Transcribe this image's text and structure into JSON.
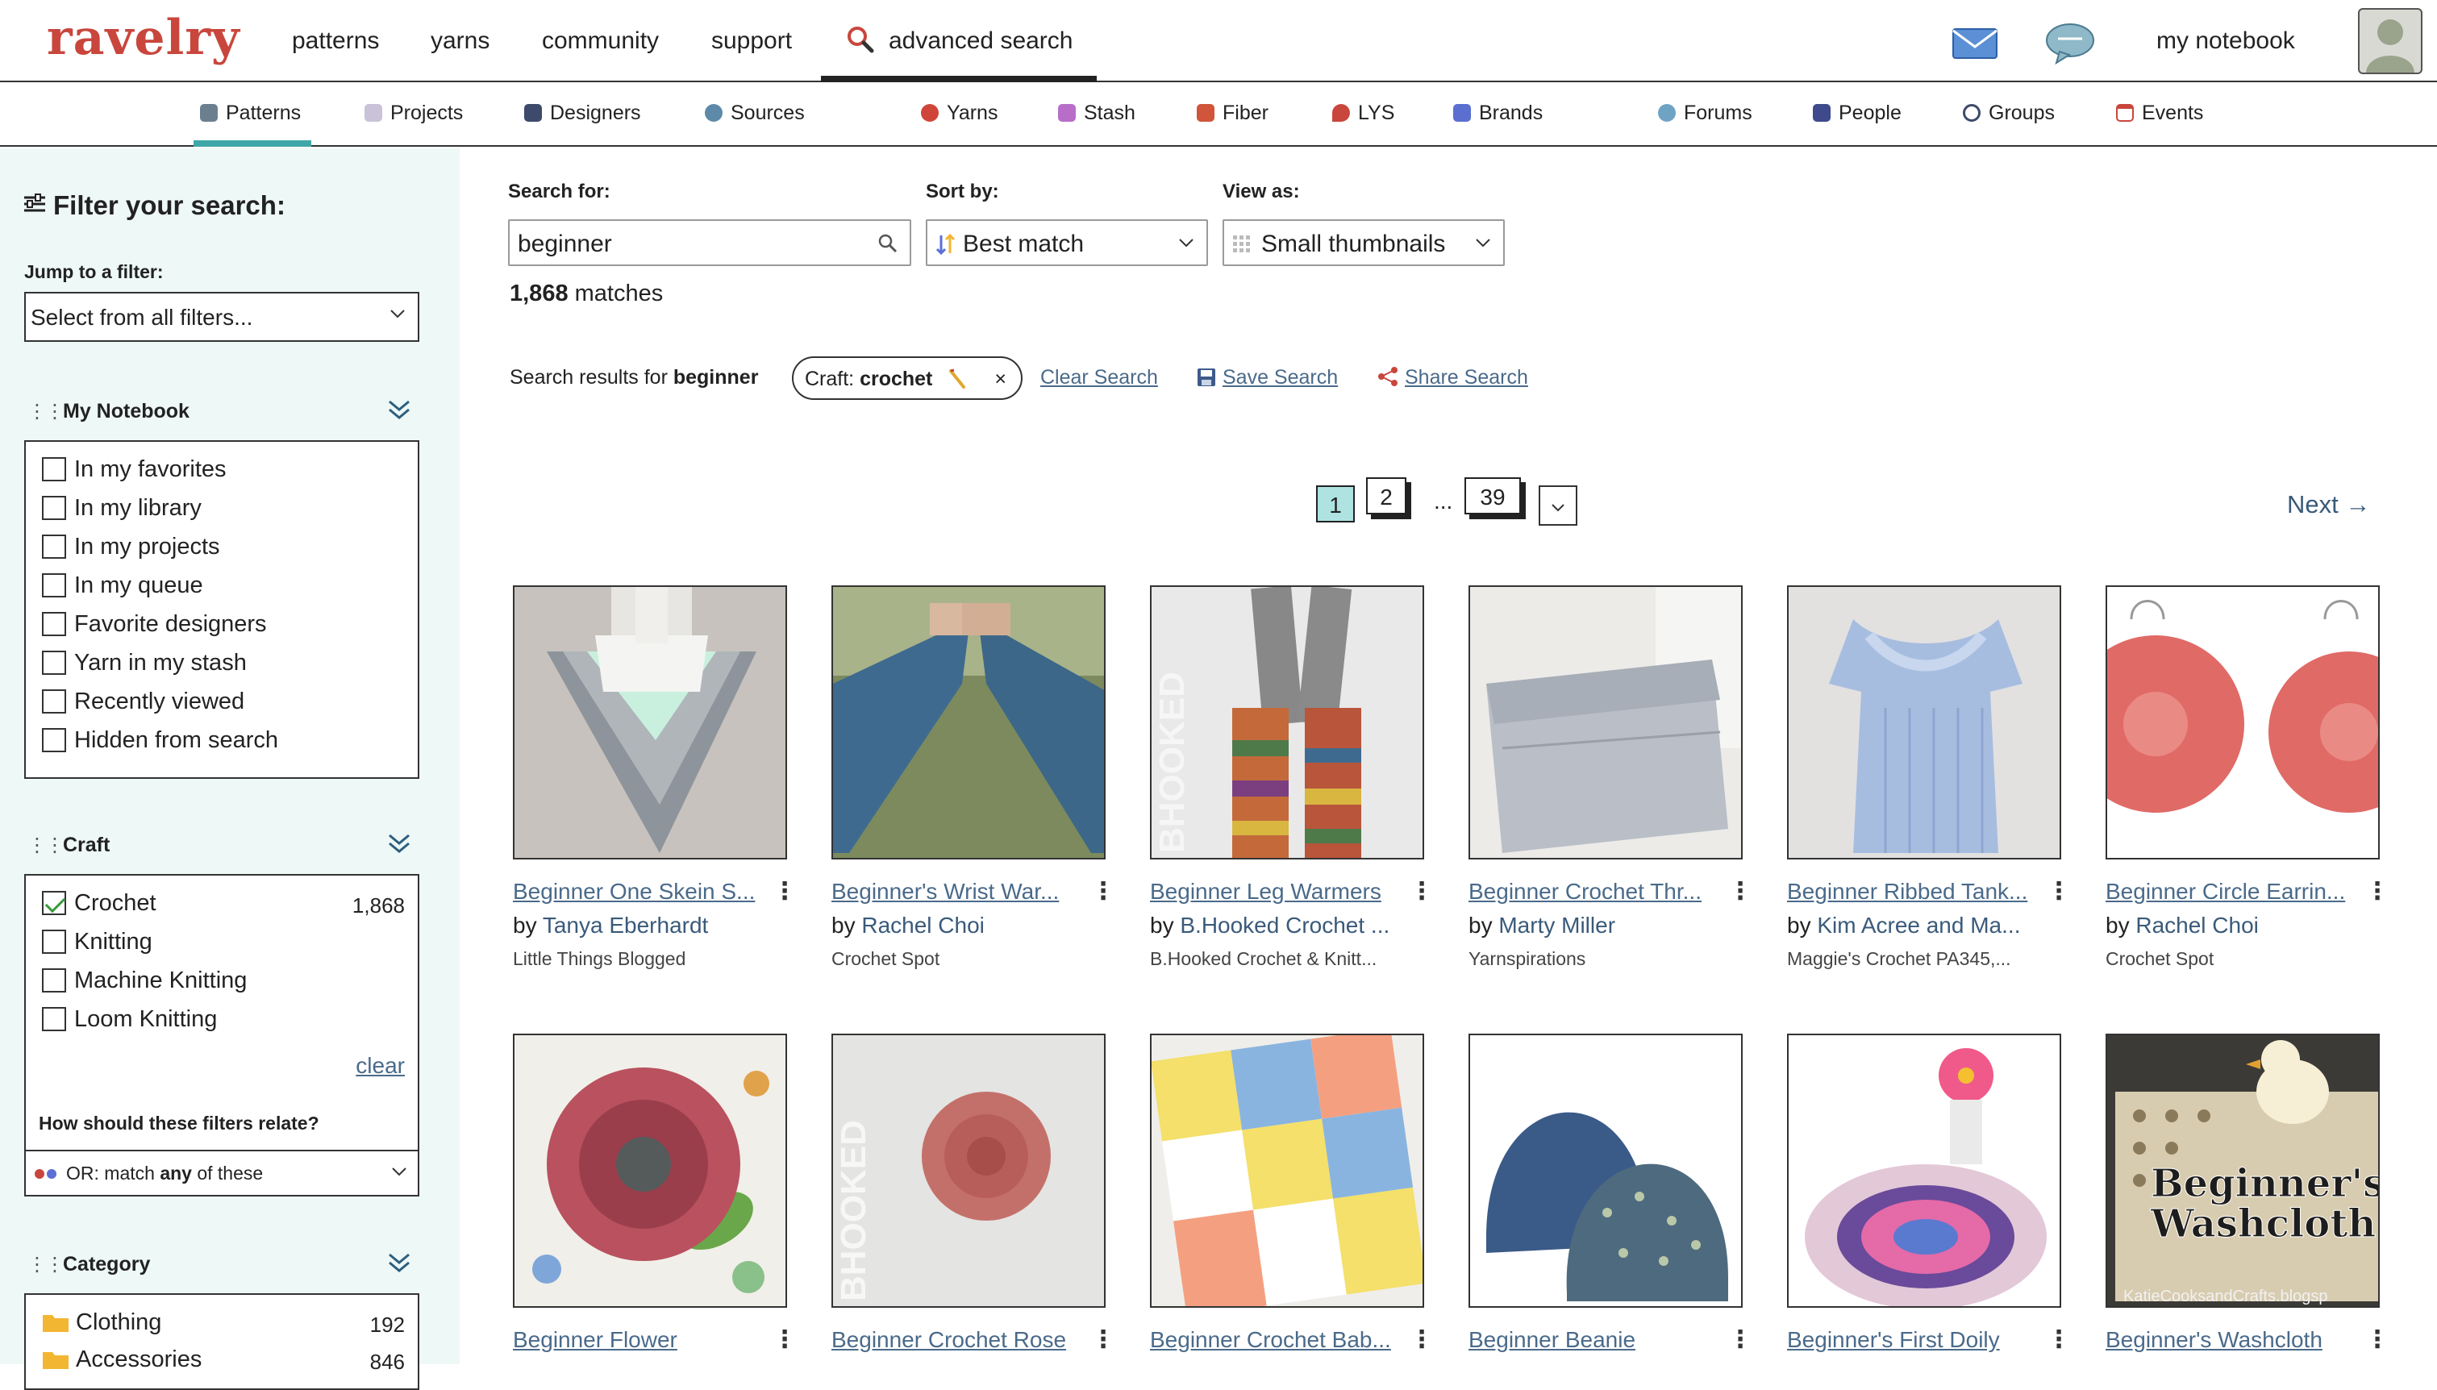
{
  "app": {
    "logo": "ravelry"
  },
  "topnav": {
    "items": [
      "patterns",
      "yarns",
      "community",
      "support"
    ],
    "advanced_search": "advanced search",
    "notebook": "my notebook"
  },
  "subnav": {
    "items": [
      "Patterns",
      "Projects",
      "Designers",
      "Sources",
      "Yarns",
      "Stash",
      "Fiber",
      "LYS",
      "Brands",
      "Forums",
      "People",
      "Groups",
      "Events"
    ]
  },
  "sidebar": {
    "title": "Filter your search:",
    "jump_label": "Jump to a filter:",
    "jump_value": "Select from all filters...",
    "my_notebook": {
      "title": "My Notebook",
      "items": [
        "In my favorites",
        "In my library",
        "In my projects",
        "In my queue",
        "Favorite designers",
        "Yarn in my stash",
        "Recently viewed",
        "Hidden from search"
      ]
    },
    "craft": {
      "title": "Craft",
      "items": [
        {
          "label": "Crochet",
          "count": "1,868",
          "checked": true
        },
        {
          "label": "Knitting",
          "count": "",
          "checked": false
        },
        {
          "label": "Machine Knitting",
          "count": "",
          "checked": false
        },
        {
          "label": "Loom Knitting",
          "count": "",
          "checked": false
        }
      ],
      "clear": "clear",
      "relate_label": "How should these filters relate?",
      "relate_prefix": "OR: match ",
      "relate_bold": "any",
      "relate_suffix": " of these"
    },
    "category": {
      "title": "Category",
      "items": [
        {
          "label": "Clothing",
          "count": "192"
        },
        {
          "label": "Accessories",
          "count": "846"
        }
      ]
    }
  },
  "search": {
    "search_for_label": "Search for:",
    "query": "beginner",
    "sort_label": "Sort by:",
    "sort_value": "Best match",
    "view_label": "View as:",
    "view_value": "Small thumbnails",
    "match_count": "1,868",
    "match_word": "matches",
    "results_prefix": "Search results for ",
    "results_query": "beginner",
    "chip_key": "Craft:",
    "chip_value": "crochet",
    "clear_search": "Clear Search",
    "save_search": "Save Search",
    "share_search": "Share Search"
  },
  "pagination": {
    "current": "1",
    "next_page": "2",
    "ellipsis": "...",
    "last": "39",
    "next": "Next →"
  },
  "results": [
    {
      "title": "Beginner One Skein S...",
      "by": "by ",
      "designer": "Tanya Eberhardt",
      "source": "Little Things Blogged"
    },
    {
      "title": "Beginner's Wrist War...",
      "by": "by ",
      "designer": "Rachel Choi",
      "source": "Crochet Spot"
    },
    {
      "title": "Beginner Leg Warmers",
      "by": "by ",
      "designer": "B.Hooked Crochet ...",
      "source": "B.Hooked Crochet & Knitt..."
    },
    {
      "title": "Beginner Crochet Thr...",
      "by": "by ",
      "designer": "Marty Miller",
      "source": "Yarnspirations"
    },
    {
      "title": "Beginner Ribbed Tank...",
      "by": "by ",
      "designer": "Kim Acree and Ma...",
      "source": "Maggie's Crochet PA345,..."
    },
    {
      "title": "Beginner Circle Earrin...",
      "by": "by ",
      "designer": "Rachel Choi",
      "source": "Crochet Spot"
    },
    {
      "title": "Beginner Flower",
      "by": "",
      "designer": "",
      "source": ""
    },
    {
      "title": "Beginner Crochet Rose",
      "by": "",
      "designer": "",
      "source": ""
    },
    {
      "title": "Beginner Crochet Bab...",
      "by": "",
      "designer": "",
      "source": ""
    },
    {
      "title": "Beginner Beanie",
      "by": "",
      "designer": "",
      "source": ""
    },
    {
      "title": "Beginner's First Doily",
      "by": "",
      "designer": "",
      "source": ""
    },
    {
      "title": "Beginner's Washcloth",
      "by": "",
      "designer": "",
      "source": ""
    }
  ],
  "thumb_text": {
    "hooked_watermark": "BHOOKED",
    "washcloth_line1": "Beginner's",
    "washcloth_line2": "Washcloth",
    "washcloth_credit": "KatieCooksandCrafts.blogsp"
  },
  "colors": {
    "brand": "#c9463d",
    "accent_teal": "#3fa7a7",
    "sidebar_bg": "#eef8f7",
    "link": "#4a6a8a"
  }
}
